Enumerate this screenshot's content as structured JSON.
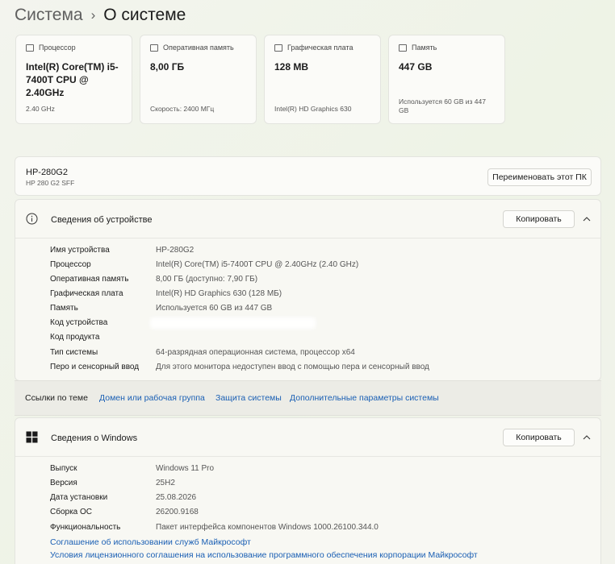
{
  "breadcrumb": {
    "parent": "Система",
    "separator": "›",
    "current": "О системе"
  },
  "specs": [
    {
      "icon": "cpu-icon",
      "title": "Процессор",
      "value": "Intel(R) Core(TM) i5-7400T CPU @ 2.40GHz",
      "sub": "2.40 GHz"
    },
    {
      "icon": "ram-icon",
      "title": "Оперативная память",
      "value": "8,00 ГБ",
      "sub": "Скорость: 2400 МГц"
    },
    {
      "icon": "gpu-icon",
      "title": "Графическая плата",
      "value": "128 MB",
      "sub": "Intel(R) HD Graphics 630"
    },
    {
      "icon": "storage-icon",
      "title": "Память",
      "value": "447 GB",
      "sub": "Используется 60 GB из 447 GB"
    }
  ],
  "device": {
    "name": "HP-280G2",
    "model": "HP 280 G2 SFF",
    "rename_label": "Переименовать этот ПК"
  },
  "device_specs": {
    "title": "Сведения об устройстве",
    "copy_label": "Копировать",
    "rows": [
      {
        "label": "Имя устройства",
        "value": "HP-280G2"
      },
      {
        "label": "Процессор",
        "value": "Intel(R) Core(TM) i5-7400T CPU @ 2.40GHz (2.40 GHz)"
      },
      {
        "label": "Оперативная память",
        "value": "8,00 ГБ (доступно: 7,90 ГБ)"
      },
      {
        "label": "Графическая плата",
        "value": "Intel(R) HD Graphics 630 (128 МБ)"
      },
      {
        "label": "Память",
        "value": "Используется 60 GB из 447 GB"
      },
      {
        "label": "Код устройства",
        "value": ""
      },
      {
        "label": "Код продукта",
        "value": ""
      },
      {
        "label": "Тип системы",
        "value": "64-разрядная операционная система, процессор x64"
      },
      {
        "label": "Перо и сенсорный ввод",
        "value": "Для этого монитора недоступен ввод с помощью пера и сенсорный ввод"
      }
    ]
  },
  "related": {
    "label": "Ссылки по теме",
    "links": [
      "Домен или рабочая группа",
      "Защита системы",
      "Дополнительные параметры системы"
    ]
  },
  "windows_specs": {
    "title": "Сведения о Windows",
    "copy_label": "Копировать",
    "rows": [
      {
        "label": "Выпуск",
        "value": "Windows 11 Pro"
      },
      {
        "label": "Версия",
        "value": "25H2"
      },
      {
        "label": "Дата установки",
        "value": "25.08.2026"
      },
      {
        "label": "Сборка ОС",
        "value": "26200.9168"
      },
      {
        "label": "Функциональность",
        "value": "Пакет интерфейса компонентов Windows 1000.26100.344.0"
      }
    ],
    "links": [
      "Соглашение об использовании служб Майкрософт",
      "Условия лицензионного соглашения на использование программного обеспечения корпорации Майкрософт"
    ]
  },
  "colors": {
    "accent_link": "#1a5fb4",
    "card_bg": "#fbfbf8",
    "background": "#eef3e6"
  }
}
